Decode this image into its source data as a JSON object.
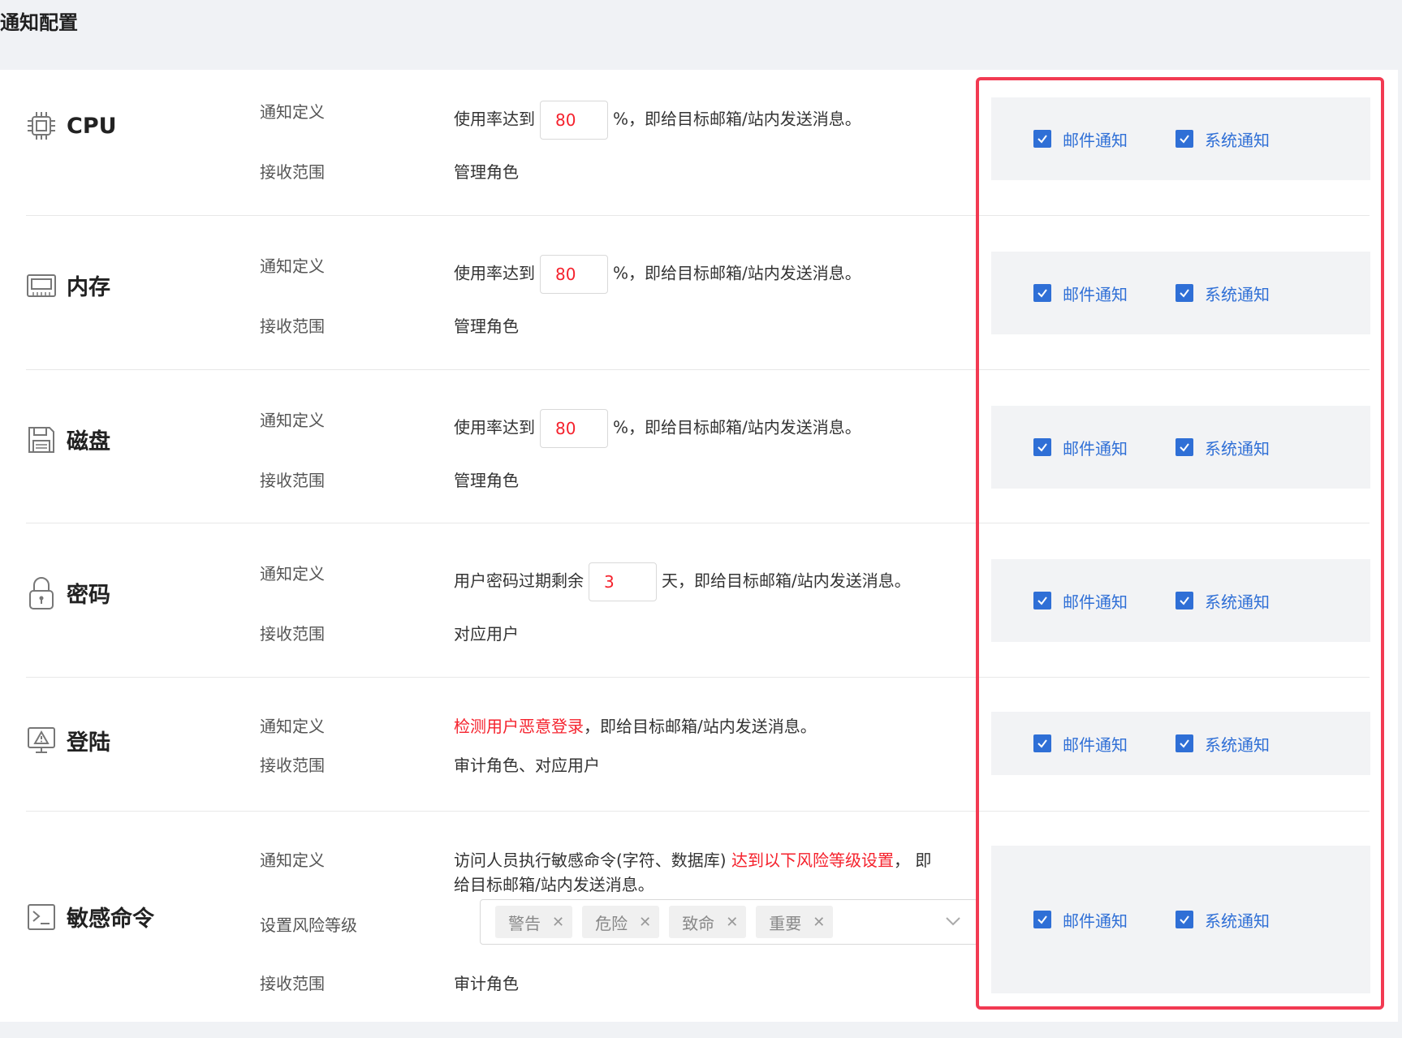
{
  "page": {
    "title": "通知配置"
  },
  "common": {
    "definition_label": "通知定义",
    "scope_label": "接收范围",
    "risk_label": "设置风险等级",
    "email_notify": "邮件通知",
    "system_notify": "系统通知"
  },
  "items": [
    {
      "name": "CPU",
      "icon": "cpu-chip-icon",
      "prefix": "使用率达到",
      "value": "80",
      "suffix": "%，即给目标邮箱/站内发送消息。",
      "scope": "管理角色",
      "email_checked": true,
      "system_checked": true
    },
    {
      "name": "内存",
      "icon": "memory-icon",
      "prefix": "使用率达到",
      "value": "80",
      "suffix": "%，即给目标邮箱/站内发送消息。",
      "scope": "管理角色",
      "email_checked": true,
      "system_checked": true
    },
    {
      "name": "磁盘",
      "icon": "disk-icon",
      "prefix": "使用率达到",
      "value": "80",
      "suffix": "%，即给目标邮箱/站内发送消息。",
      "scope": "管理角色",
      "email_checked": true,
      "system_checked": true
    },
    {
      "name": "密码",
      "icon": "lock-icon",
      "prefix": "用户密码过期剩余",
      "value": "3",
      "suffix": "天，即给目标邮箱/站内发送消息。",
      "scope": "对应用户",
      "email_checked": true,
      "system_checked": true
    },
    {
      "name": "登陆",
      "icon": "monitor-warning-icon",
      "red_text": "检测用户恶意登录",
      "suffix": "，即给目标邮箱/站内发送消息。",
      "scope": "审计角色、对应用户",
      "email_checked": true,
      "system_checked": true
    },
    {
      "name": "敏感命令",
      "icon": "terminal-icon",
      "line1_prefix": "访问人员执行敏感命令(字符、数据库) ",
      "line1_red": "达到以下风险等级设置",
      "line1_suffix": "，  即",
      "line2": "给目标邮箱/站内发送消息。",
      "tags": [
        "警告",
        "危险",
        "致命",
        "重要"
      ],
      "scope": "审计角色",
      "email_checked": true,
      "system_checked": true
    }
  ],
  "colors": {
    "accent": "#2f6fd6",
    "danger": "#f5222d",
    "highlight_border": "#f23a52"
  }
}
